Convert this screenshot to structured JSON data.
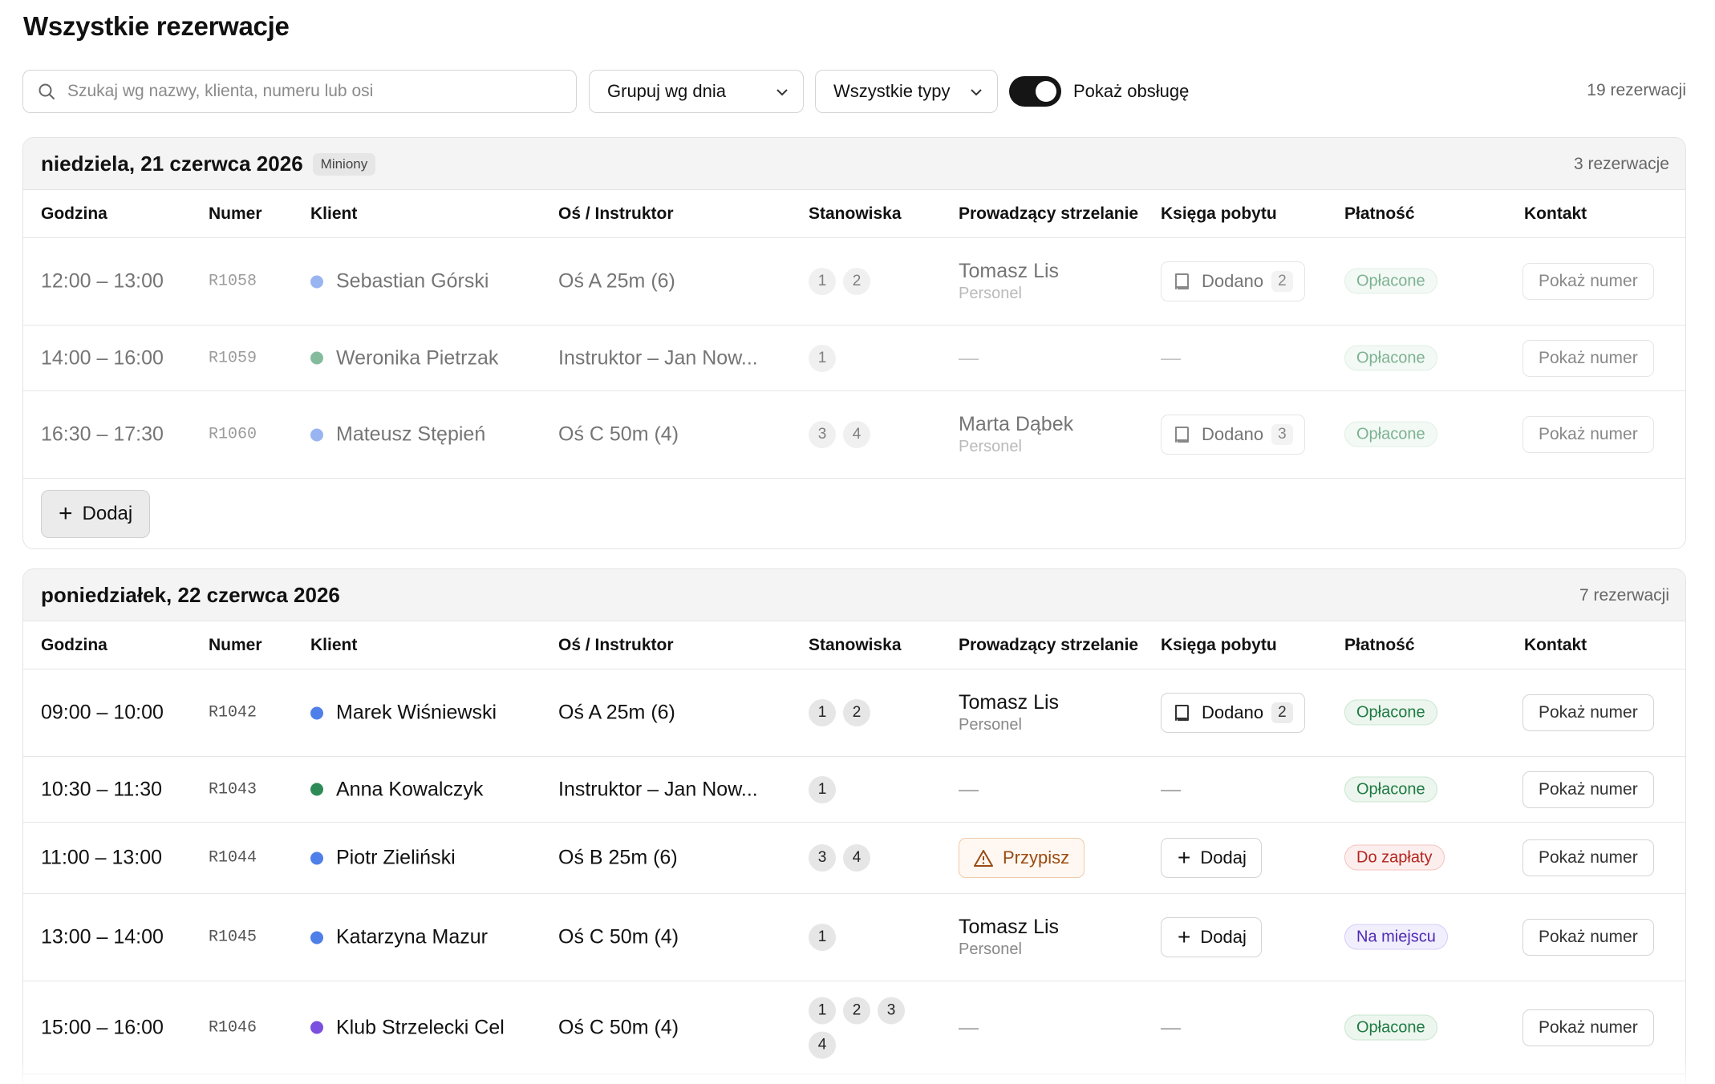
{
  "page": {
    "title": "Wszystkie rezerwacje"
  },
  "toolbar": {
    "search_placeholder": "Szukaj wg nazwy, klienta, numeru lub osi",
    "group_by": "Grupuj wg dnia",
    "type_filter": "Wszystkie typy",
    "toggle_label": "Pokaż obsługę",
    "toggle_on": true,
    "total": "19 rezerwacji"
  },
  "columns": {
    "time": "Godzina",
    "number": "Numer",
    "client": "Klient",
    "lane": "Oś / Instruktor",
    "stations": "Stanowiska",
    "officer": "Prowadzący strzelanie",
    "log": "Księga pobytu",
    "payment": "Płatność",
    "contact": "Kontakt"
  },
  "labels": {
    "show_number": "Pokaż numer",
    "added": "Dodano",
    "add": "Dodaj",
    "assign": "Przypisz",
    "dash": "—"
  },
  "colors": {
    "blue": "#4f7fe8",
    "green": "#2e8b57",
    "purple": "#7b4fe0"
  },
  "groups": [
    {
      "date": "niedziela, 21 czerwca 2026",
      "badge": "Miniony",
      "count": "3 rezerwacje",
      "add_label": "Dodaj",
      "rows": [
        {
          "time": "12:00 – 13:00",
          "number": "R1058",
          "client": "Sebastian Górski",
          "dot": "#4f7fe8",
          "lane": "Oś A 25m (6)",
          "stations": [
            "1",
            "2"
          ],
          "officer": {
            "name": "Tomasz Lis",
            "role": "Personel"
          },
          "log": {
            "state": "added",
            "label": "Dodano",
            "count": "2"
          },
          "payment": {
            "label": "Opłacone",
            "kind": "paid"
          },
          "contact": "Pokaż numer"
        },
        {
          "time": "14:00 – 16:00",
          "number": "R1059",
          "client": "Weronika Pietrzak",
          "dot": "#2e8b57",
          "lane": "Instruktor – Jan Now...",
          "stations": [
            "1"
          ],
          "officer": null,
          "log": null,
          "payment": {
            "label": "Opłacone",
            "kind": "paid"
          },
          "contact": "Pokaż numer"
        },
        {
          "time": "16:30 – 17:30",
          "number": "R1060",
          "client": "Mateusz Stępień",
          "dot": "#4f7fe8",
          "lane": "Oś C 50m (4)",
          "stations": [
            "3",
            "4"
          ],
          "officer": {
            "name": "Marta Dąbek",
            "role": "Personel"
          },
          "log": {
            "state": "added",
            "label": "Dodano",
            "count": "3"
          },
          "payment": {
            "label": "Opłacone",
            "kind": "paid"
          },
          "contact": "Pokaż numer"
        }
      ]
    },
    {
      "date": "poniedziałek, 22 czerwca 2026",
      "badge": "",
      "count": "7 rezerwacji",
      "rows": [
        {
          "time": "09:00 – 10:00",
          "number": "R1042",
          "client": "Marek Wiśniewski",
          "dot": "#4f7fe8",
          "lane": "Oś A 25m (6)",
          "stations": [
            "1",
            "2"
          ],
          "officer": {
            "name": "Tomasz Lis",
            "role": "Personel"
          },
          "log": {
            "state": "added",
            "label": "Dodano",
            "count": "2"
          },
          "payment": {
            "label": "Opłacone",
            "kind": "paid"
          },
          "contact": "Pokaż numer"
        },
        {
          "time": "10:30 – 11:30",
          "number": "R1043",
          "client": "Anna Kowalczyk",
          "dot": "#2e8b57",
          "lane": "Instruktor – Jan Now...",
          "stations": [
            "1"
          ],
          "officer": null,
          "log": null,
          "payment": {
            "label": "Opłacone",
            "kind": "paid"
          },
          "contact": "Pokaż numer"
        },
        {
          "time": "11:00 – 13:00",
          "number": "R1044",
          "client": "Piotr Zieliński",
          "dot": "#4f7fe8",
          "lane": "Oś B 25m (6)",
          "stations": [
            "3",
            "4"
          ],
          "officer": {
            "assign": "Przypisz"
          },
          "log": {
            "state": "add",
            "label": "Dodaj"
          },
          "payment": {
            "label": "Do zapłaty",
            "kind": "due"
          },
          "contact": "Pokaż numer"
        },
        {
          "time": "13:00 – 14:00",
          "number": "R1045",
          "client": "Katarzyna Mazur",
          "dot": "#4f7fe8",
          "lane": "Oś C 50m (4)",
          "stations": [
            "1"
          ],
          "officer": {
            "name": "Tomasz Lis",
            "role": "Personel"
          },
          "log": {
            "state": "add",
            "label": "Dodaj"
          },
          "payment": {
            "label": "Na miejscu",
            "kind": "onsite"
          },
          "contact": "Pokaż numer"
        },
        {
          "time": "15:00 – 16:00",
          "number": "R1046",
          "client": "Klub Strzelecki Cel",
          "dot": "#7b4fe0",
          "lane": "Oś C 50m (4)",
          "stations": [
            "1",
            "2",
            "3",
            "4"
          ],
          "officer": null,
          "log": null,
          "payment": {
            "label": "Opłacone",
            "kind": "paid"
          },
          "contact": "Pokaż numer"
        }
      ]
    }
  ]
}
